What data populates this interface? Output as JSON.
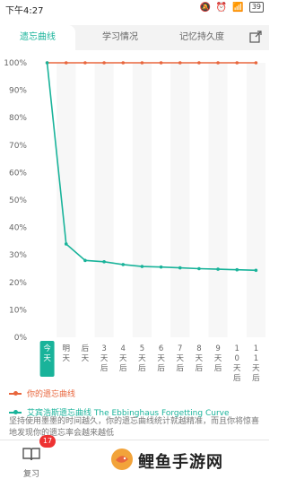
{
  "status_bar": {
    "time": "下午4:27",
    "icons": [
      "mute-icon",
      "alarm-icon",
      "sim-icon",
      "wifi-icon",
      "battery-icon"
    ],
    "battery_level": "39"
  },
  "tabs": [
    {
      "label": "遗忘曲线",
      "active": true
    },
    {
      "label": "学习情况",
      "active": false
    },
    {
      "label": "记忆持久度",
      "active": false
    }
  ],
  "share_icon": "share-icon",
  "chart_data": {
    "type": "line",
    "ylim": [
      0,
      100
    ],
    "y_ticks": [
      "100%",
      "90%",
      "80%",
      "70%",
      "60%",
      "50%",
      "40%",
      "30%",
      "20%",
      "10%",
      "0%"
    ],
    "x_categories": [
      "今天",
      "明天",
      "后天",
      "3天后",
      "4天后",
      "5天后",
      "6天后",
      "7天后",
      "8天后",
      "9天后",
      "10天后",
      "11天后"
    ],
    "series": [
      {
        "name": "你的遗忘曲线",
        "color": "#e8663d",
        "values": [
          100,
          100,
          100,
          100,
          100,
          100,
          100,
          100,
          100,
          100,
          100,
          100
        ]
      },
      {
        "name": "艾宾浩斯遗忘曲线 The Ebbinghaus Forgetting Curve",
        "color": "#19b39a",
        "values": [
          100,
          34,
          28,
          27.5,
          26.5,
          25.8,
          25.6,
          25.3,
          25,
          24.8,
          24.6,
          24.4
        ]
      }
    ]
  },
  "legend": {
    "your_curve": "你的遗忘曲线",
    "ebbinghaus_curve": "艾宾浩斯遗忘曲线 The Ebbinghaus Forgetting Curve"
  },
  "description": "坚持使用墨墨的时间越久，你的遗忘曲线统计就越精准，而且你将惊喜地发现你的遗忘率会越来越低",
  "bottom_bar": {
    "review_label": "复习",
    "badge_count": "17",
    "watermark": "鲤鱼手游网"
  }
}
